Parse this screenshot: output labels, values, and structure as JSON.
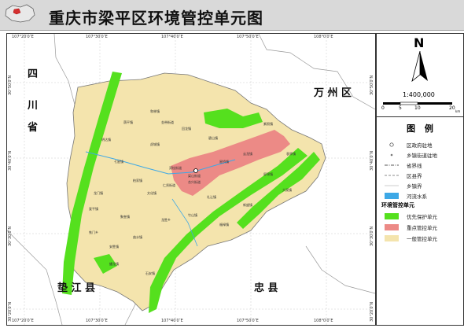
{
  "title": "重庆市梁平区环境管控单元图",
  "colors": {
    "title_bar": "#d9d9d9",
    "priority_unit": "#55e01e",
    "key_unit": "#ec8a86",
    "general_unit": "#f4e4ad",
    "river": "#3da8e6",
    "boundary": "#8a8a8a"
  },
  "coords": {
    "top": [
      "107°20′0″E",
      "107°30′0″E",
      "107°40′0″E",
      "107°50′0″E",
      "108°0′0″E"
    ],
    "bottom": [
      "107°20′0″E",
      "107°30′0″E",
      "107°40′0″E",
      "107°50′0″E",
      "108°0′0″E"
    ],
    "left": [
      "30°50′0″N",
      "30°40′0″N",
      "30°30′0″N",
      "30°20′0″N"
    ],
    "right": [
      "30°50′0″N",
      "30°40′0″N",
      "30°30′0″N",
      "30°20′0″N"
    ]
  },
  "neighbors": {
    "sichuan": [
      "四",
      "川",
      "省"
    ],
    "wanzhou": "万 州 区",
    "dianjiang": "垫 江 县",
    "zhongxian": "忠 县"
  },
  "north_arrow": {
    "letter": "N"
  },
  "scale": {
    "ratio": "1:400,000",
    "ticks": [
      "0",
      "5",
      "10",
      "20"
    ],
    "unit": "km"
  },
  "legend": {
    "title": "图  例",
    "items": [
      {
        "label": "区政府驻地",
        "icon": "circle-dot-icon"
      },
      {
        "label": "乡镇街道驻地",
        "icon": "small-dot-icon"
      },
      {
        "label": "省界线",
        "icon": "dash-dot-line-icon"
      },
      {
        "label": "区县界",
        "icon": "dash-line-icon"
      },
      {
        "label": "乡镇界",
        "icon": "thin-line-icon"
      },
      {
        "label": "河流水系",
        "icon": "blue-fill-icon"
      }
    ],
    "unit_heading": "环境管控单元",
    "units": [
      {
        "label": "优先保护单元",
        "color": "#55e01e"
      },
      {
        "label": "重点管控单元",
        "color": "#ec8a86"
      },
      {
        "label": "一般管控单元",
        "color": "#f4e4ad"
      }
    ]
  },
  "towns": [
    "梁山街道",
    "双桂街道",
    "仁贤街道",
    "礼让镇",
    "云龙镇",
    "屏锦镇",
    "袁驿镇",
    "新盛镇",
    "福禄镇",
    "聚奎镇",
    "明达镇",
    "荫平镇",
    "和林镇",
    "回龙镇",
    "碧山镇",
    "虎城镇",
    "七星镇",
    "龙门镇",
    "文化镇",
    "合兴街道",
    "曲水镇",
    "安胜镇",
    "铁门乡",
    "龙胜乡",
    "大观镇",
    "紫照镇",
    "金带街道",
    "竹山镇",
    "柏家镇",
    "蟠龙镇",
    "星桥镇",
    "复平镇",
    "石安镇"
  ]
}
